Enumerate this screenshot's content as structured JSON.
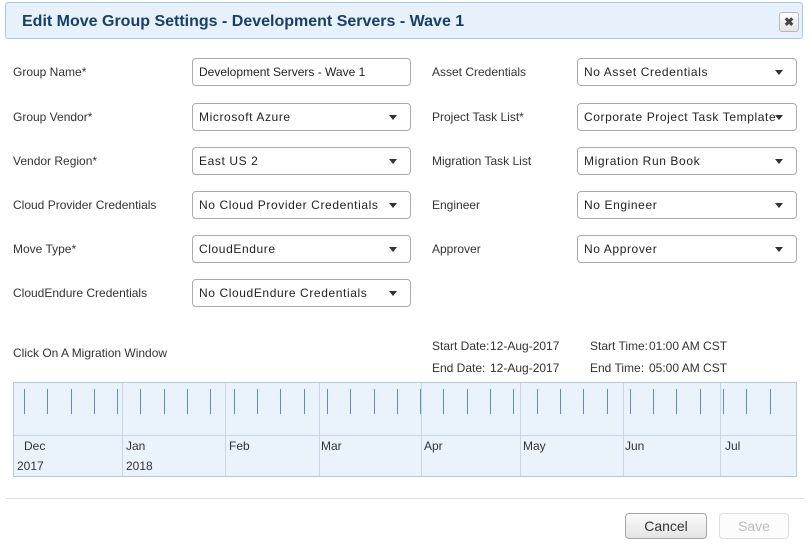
{
  "dialog": {
    "title": "Edit Move Group Settings - Development Servers - Wave 1",
    "close_icon": "close-icon"
  },
  "form": {
    "group_name": {
      "label": "Group Name*",
      "value": "Development Servers - Wave 1"
    },
    "group_vendor": {
      "label": "Group Vendor*",
      "value": "Microsoft Azure"
    },
    "vendor_region": {
      "label": "Vendor Region*",
      "value": "East US 2"
    },
    "cloud_provider_credentials": {
      "label": "Cloud Provider Credentials",
      "value": "No Cloud Provider Credentials"
    },
    "move_type": {
      "label": "Move Type*",
      "value": "CloudEndure"
    },
    "cloudendure_credentials": {
      "label": "CloudEndure Credentials",
      "value": "No CloudEndure Credentials"
    },
    "asset_credentials": {
      "label": "Asset Credentials",
      "value": "No Asset Credentials"
    },
    "project_task_list": {
      "label": "Project Task List*",
      "value": "Corporate Project Task Template"
    },
    "migration_task_list": {
      "label": "Migration Task List",
      "value": "Migration Run Book"
    },
    "engineer": {
      "label": "Engineer",
      "value": "No Engineer"
    },
    "approver": {
      "label": "Approver",
      "value": "No Approver"
    }
  },
  "migration_window": {
    "prompt": "Click On A Migration Window",
    "start_date_label": "Start Date:",
    "start_date": "12-Aug-2017",
    "end_date_label": "End Date:",
    "end_date": "12-Aug-2017",
    "start_time_label": "Start Time:",
    "start_time": "01:00 AM CST",
    "end_time_label": "End Time:",
    "end_time": "05:00 AM CST"
  },
  "timeline": {
    "months": [
      "Dec",
      "Jan",
      "Feb",
      "Mar",
      "Apr",
      "May",
      "Jun",
      "Jul"
    ],
    "years": [
      "2017",
      "2018"
    ]
  },
  "footer": {
    "cancel_label": "Cancel",
    "save_label": "Save"
  },
  "colors": {
    "header_bg": "#e7f1fb",
    "title_color": "#1a3f66",
    "timeline_tick": "#5d91c6"
  }
}
